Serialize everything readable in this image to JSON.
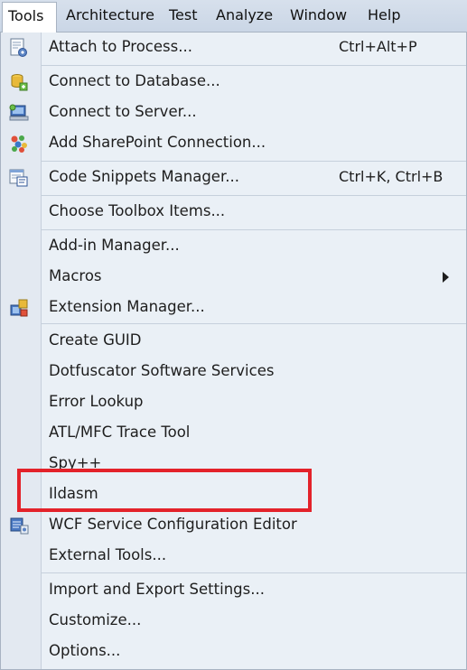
{
  "menubar": {
    "items": [
      {
        "label": "Tools"
      },
      {
        "label": "Architecture"
      },
      {
        "label": "Test"
      },
      {
        "label": "Analyze"
      },
      {
        "label": "Window"
      },
      {
        "label": "Help"
      }
    ]
  },
  "menu": {
    "items": [
      {
        "label": "Attach to Process...",
        "shortcut": "Ctrl+Alt+P",
        "icon": "attach-process-icon"
      },
      {
        "label": "Connect to Database...",
        "icon": "database-connect-icon"
      },
      {
        "label": "Connect to Server...",
        "icon": "server-connect-icon"
      },
      {
        "label": "Add SharePoint Connection...",
        "icon": "sharepoint-icon"
      },
      {
        "label": "Code Snippets Manager...",
        "shortcut": "Ctrl+K, Ctrl+B",
        "icon": "code-snippets-icon"
      },
      {
        "label": "Choose Toolbox Items..."
      },
      {
        "label": "Add-in Manager..."
      },
      {
        "label": "Macros",
        "submenu": true
      },
      {
        "label": "Extension Manager...",
        "icon": "extension-manager-icon"
      },
      {
        "label": "Create GUID"
      },
      {
        "label": "Dotfuscator Software Services"
      },
      {
        "label": "Error Lookup"
      },
      {
        "label": "ATL/MFC Trace Tool"
      },
      {
        "label": "Spy++"
      },
      {
        "label": "Ildasm"
      },
      {
        "label": "WCF Service Configuration Editor",
        "icon": "wcf-config-icon"
      },
      {
        "label": "External Tools..."
      },
      {
        "label": "Import and Export Settings..."
      },
      {
        "label": "Customize..."
      },
      {
        "label": "Options..."
      }
    ]
  },
  "colors": {
    "highlight_box": "#e3222a",
    "menu_background": "#eaf0f6"
  }
}
